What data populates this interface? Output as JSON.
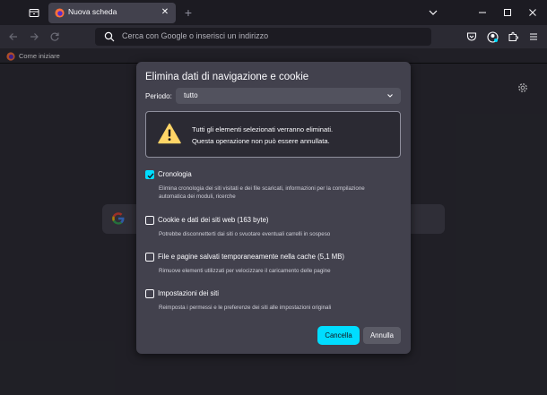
{
  "tabs": [
    {
      "label": "Nuova scheda",
      "icon": "firefox-logo-icon",
      "active": true
    }
  ],
  "toolbar": {
    "url_placeholder": "Cerca con Google o inserisci un indirizzo"
  },
  "bookmarks": [
    {
      "label": "Come iniziare",
      "icon": "firefox-logo-icon"
    }
  ],
  "dialog": {
    "title": "Elimina dati di navigazione e cookie",
    "period_label": "Periodo:",
    "period_value": "tutto",
    "warning": {
      "line1": "Tutti gli elementi selezionati verranno eliminati.",
      "line2": "Questa operazione non può essere annullata."
    },
    "options": [
      {
        "label": "Cronologia",
        "checked": true,
        "description": "Elimina cronologia dei siti visitati e dei file scaricati, informazioni per la compilazione automatica dei moduli, ricerche"
      },
      {
        "label": "Cookie e dati dei siti web (163 byte)",
        "checked": false,
        "description": "Potrebbe disconnetterti dai siti o svuotare eventuali carrelli in sospeso"
      },
      {
        "label": "File e pagine salvati temporaneamente nella cache (5,1 MB)",
        "checked": false,
        "description": "Rimuove elementi utilizzati per velocizzare il caricamento delle pagine"
      },
      {
        "label": "Impostazioni dei siti",
        "checked": false,
        "description": "Reimposta i permessi e le preferenze dei siti alle impostazioni originali"
      }
    ],
    "cancel_label": "Cancella",
    "clear_label": "Annulla"
  },
  "colors": {
    "accent": "#00ddff",
    "dialog_bg": "#42414d",
    "page_bg": "#2b2a33",
    "warning_yellow": "#ffd567"
  }
}
